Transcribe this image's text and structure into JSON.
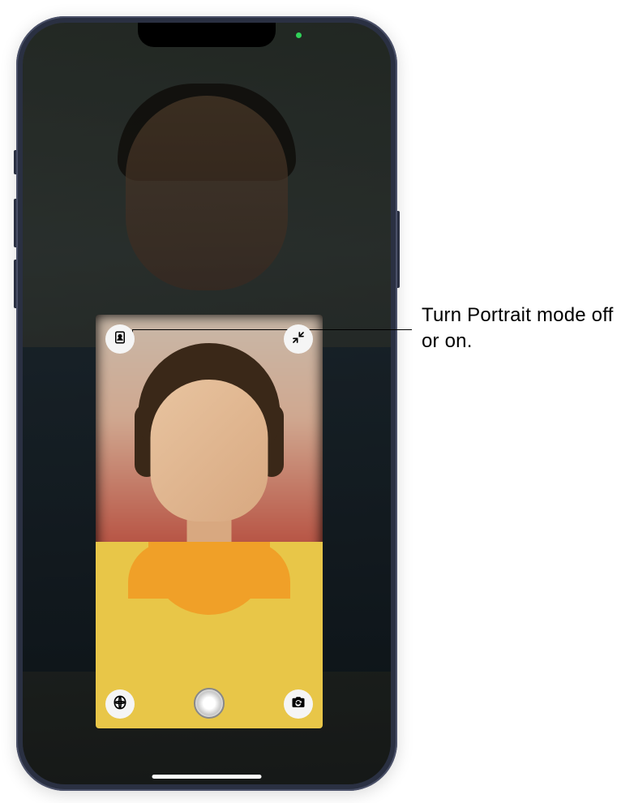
{
  "status": {
    "camera_indicator": "active"
  },
  "call": {
    "remote_video": "remote caller video feed",
    "self_view": "local user video preview"
  },
  "self_view_controls": {
    "portrait_icon": "portrait-mode",
    "collapse_icon": "collapse",
    "effects_icon": "effects",
    "shutter_icon": "capture-photo",
    "flip_icon": "flip-camera"
  },
  "callouts": {
    "portrait": "Turn Portrait mode off or on."
  }
}
